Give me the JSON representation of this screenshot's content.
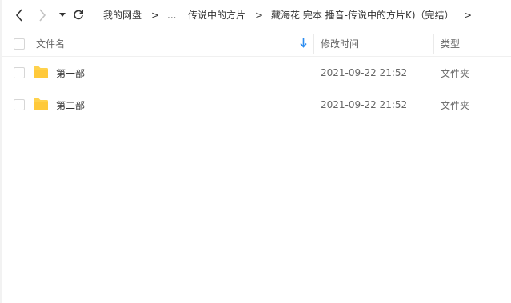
{
  "nav": {
    "back_icon": "chevron-left-icon",
    "forward_icon": "chevron-right-icon",
    "history_icon": "caret-down-icon",
    "refresh_icon": "refresh-icon"
  },
  "breadcrumb": {
    "items": [
      "我的网盘",
      "...",
      "传说中的方片",
      "藏海花 完本 播音-传说中的方片K)（完结）"
    ],
    "separator": ">"
  },
  "table": {
    "headers": {
      "name": "文件名",
      "modified": "修改时间",
      "type": "类型"
    },
    "sort_icon": "arrow-down-icon",
    "rows": [
      {
        "name": "第一部",
        "modified": "2021-09-22 21:52",
        "type": "文件夹",
        "icon": "folder-icon"
      },
      {
        "name": "第二部",
        "modified": "2021-09-22 21:52",
        "type": "文件夹",
        "icon": "folder-icon"
      }
    ]
  },
  "colors": {
    "accent": "#2b8cf0",
    "folder": "#ffd24d",
    "text": "#333333",
    "muted": "#666666"
  }
}
